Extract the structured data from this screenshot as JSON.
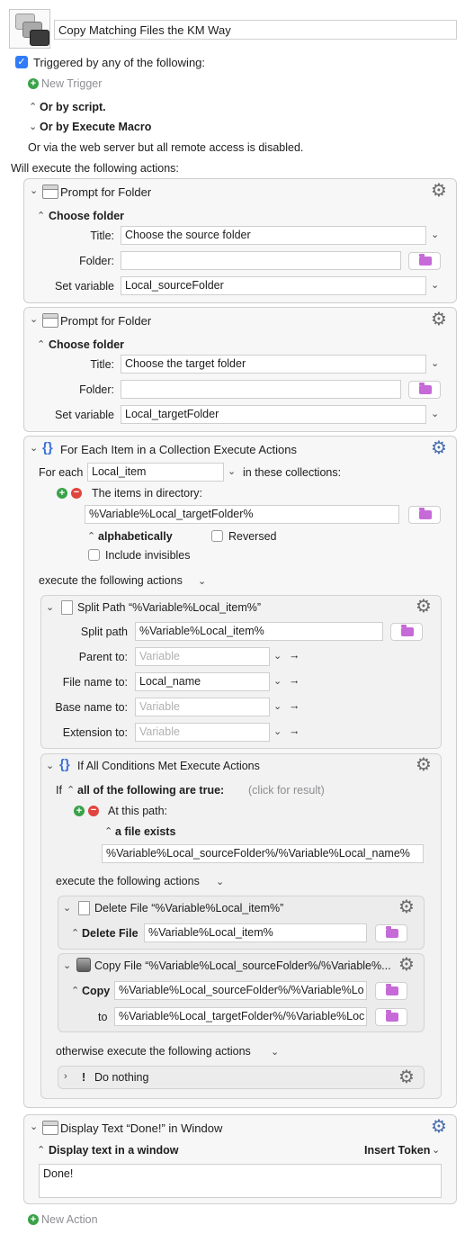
{
  "macro": {
    "name": "Copy Matching Files the KM Way"
  },
  "triggers": {
    "triggered_label": "Triggered by any of the following:",
    "new_trigger": "New Trigger",
    "or_by_script": "Or by script.",
    "or_by_execute_macro": "Or by Execute Macro",
    "web_server_note": "Or via the web server but all remote access is disabled."
  },
  "will_execute": "Will execute the following actions:",
  "actions": {
    "prompt1": {
      "title": "Prompt for Folder",
      "mode": "Choose folder",
      "title_label": "Title:",
      "title_value": "Choose the source folder",
      "folder_label": "Folder:",
      "folder_value": "",
      "setvar_label": "Set variable",
      "setvar_value": "Local_sourceFolder"
    },
    "prompt2": {
      "title": "Prompt for Folder",
      "mode": "Choose folder",
      "title_label": "Title:",
      "title_value": "Choose the target folder",
      "folder_label": "Folder:",
      "folder_value": "",
      "setvar_label": "Set variable",
      "setvar_value": "Local_targetFolder"
    },
    "foreach": {
      "title": "For Each Item in a Collection Execute Actions",
      "for_each_label": "For each",
      "item_var": "Local_item",
      "in_collections": "in these collections:",
      "collection_label": "The items in directory:",
      "directory_value": "%Variable%Local_targetFolder%",
      "sort": "alphabetically",
      "reversed": "Reversed",
      "include_invisibles": "Include invisibles",
      "execute_label": "execute the following actions",
      "split": {
        "title": "Split Path “%Variable%Local_item%”",
        "split_path_label": "Split path",
        "split_path_value": "%Variable%Local_item%",
        "parent_label": "Parent to:",
        "parent_value": "Variable",
        "filename_label": "File name to:",
        "filename_value": "Local_name",
        "basename_label": "Base name to:",
        "basename_value": "Variable",
        "extension_label": "Extension to:",
        "extension_value": "Variable"
      },
      "ifall": {
        "title": "If All Conditions Met Execute Actions",
        "if_label": "If",
        "condition_mode": "all of the following are true:",
        "click_result": "(click for result)",
        "at_path_label": "At this path:",
        "path_condition": "a file exists",
        "path_value": "%Variable%Local_sourceFolder%/%Variable%Local_name%",
        "execute_label": "execute the following actions",
        "delete": {
          "title": "Delete File “%Variable%Local_item%”",
          "label": "Delete File",
          "value": "%Variable%Local_item%"
        },
        "copy": {
          "title": "Copy File “%Variable%Local_sourceFolder%/%Variable%...",
          "label": "Copy",
          "from_value": "%Variable%Local_sourceFolder%/%Variable%Lo",
          "to_label": "to",
          "to_value": "%Variable%Local_targetFolder%/%Variable%Loc"
        },
        "otherwise_label": "otherwise execute the following actions",
        "nothing": {
          "title": "Do nothing"
        }
      }
    },
    "display": {
      "title": "Display Text “Done!” in Window",
      "mode": "Display text in a window",
      "insert_token": "Insert Token",
      "text": "Done!"
    }
  },
  "new_action": "New Action",
  "colors": {
    "accent_blue": "#2f7cf6",
    "add_green": "#3aa24a",
    "remove_red": "#e0443e",
    "folder_purple": "#c66ad8"
  }
}
